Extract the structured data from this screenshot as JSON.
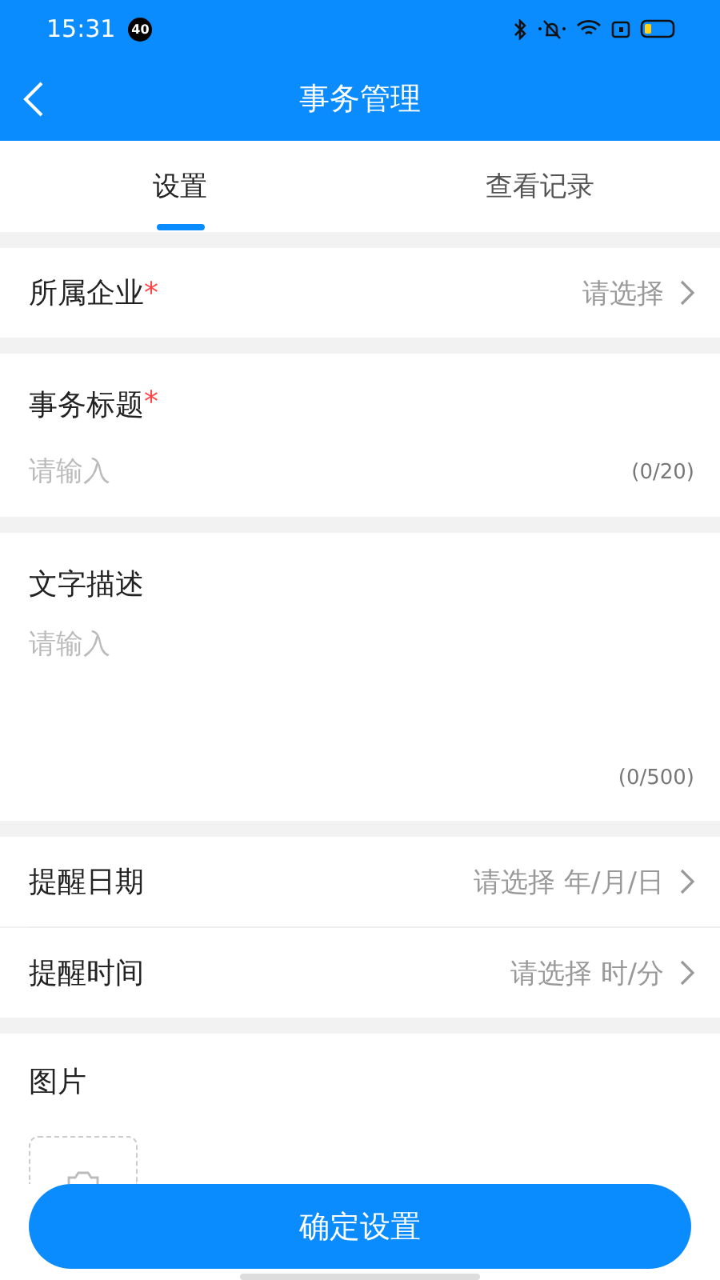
{
  "status_bar": {
    "time": "15:31",
    "badge": "40"
  },
  "header": {
    "title": "事务管理"
  },
  "tabs": [
    {
      "label": "设置",
      "selected": true
    },
    {
      "label": "查看记录",
      "selected": false
    }
  ],
  "company": {
    "label": "所属企业",
    "required_mark": "*",
    "value": "请选择"
  },
  "title_field": {
    "label": "事务标题",
    "required_mark": "*",
    "placeholder": "请输入",
    "counter": "(0/20)"
  },
  "description": {
    "label": "文字描述",
    "placeholder": "请输入",
    "counter": "(0/500)"
  },
  "reminder_rows": [
    {
      "label": "提醒日期",
      "value": "请选择 年/月/日"
    },
    {
      "label": "提醒时间",
      "value": "请选择 时/分"
    }
  ],
  "picture": {
    "label": "图片"
  },
  "submit_button": "确定设置"
}
